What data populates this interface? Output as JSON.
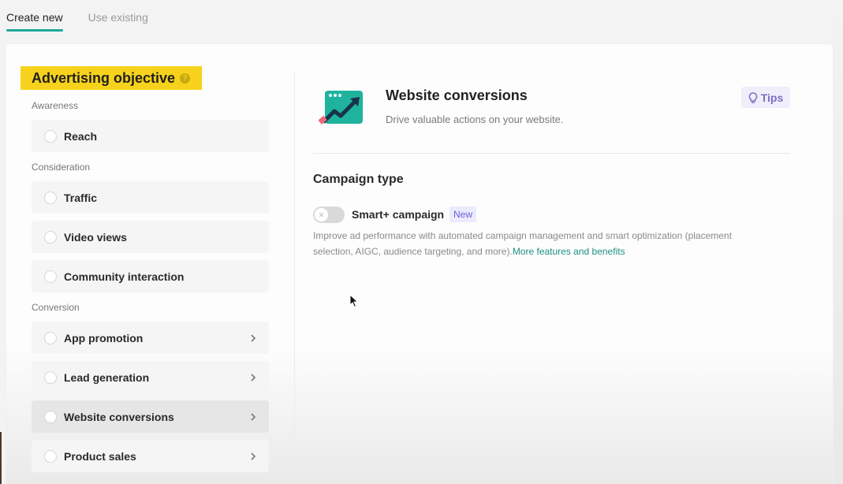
{
  "tabs": [
    {
      "label": "Create new",
      "active": true
    },
    {
      "label": "Use existing",
      "active": false
    }
  ],
  "objective": {
    "title": "Advertising objective",
    "help_icon": "question-circle-icon",
    "groups": [
      {
        "label": "Awareness",
        "options": [
          {
            "label": "Reach",
            "has_chevron": false,
            "selected": false
          }
        ]
      },
      {
        "label": "Consideration",
        "options": [
          {
            "label": "Traffic",
            "has_chevron": false,
            "selected": false
          },
          {
            "label": "Video views",
            "has_chevron": false,
            "selected": false
          },
          {
            "label": "Community interaction",
            "has_chevron": false,
            "selected": false
          }
        ]
      },
      {
        "label": "Conversion",
        "options": [
          {
            "label": "App promotion",
            "has_chevron": true,
            "selected": false
          },
          {
            "label": "Lead generation",
            "has_chevron": true,
            "selected": false
          },
          {
            "label": "Website conversions",
            "has_chevron": true,
            "selected": true
          },
          {
            "label": "Product sales",
            "has_chevron": true,
            "selected": false
          }
        ]
      }
    ]
  },
  "detail": {
    "icon": "website-conversion-chart-icon",
    "title": "Website conversions",
    "description": "Drive valuable actions on your website.",
    "tips_label": "Tips",
    "tips_icon": "lightbulb-icon"
  },
  "campaign_type": {
    "title": "Campaign type",
    "smart_campaign": {
      "label": "Smart+ campaign",
      "badge": "New",
      "enabled": false,
      "description": "Improve ad performance with automated campaign management and smart optimization (placement selection, AIGC, audience targeting, and more).",
      "link_text": "More features and benefits"
    }
  },
  "colors": {
    "accent_teal": "#1fa89b",
    "highlight_yellow": "#f7d21c",
    "tips_purple": "#7b6fc4",
    "badge_purple": "#6c5fd6",
    "link_green": "#1f8f83"
  }
}
